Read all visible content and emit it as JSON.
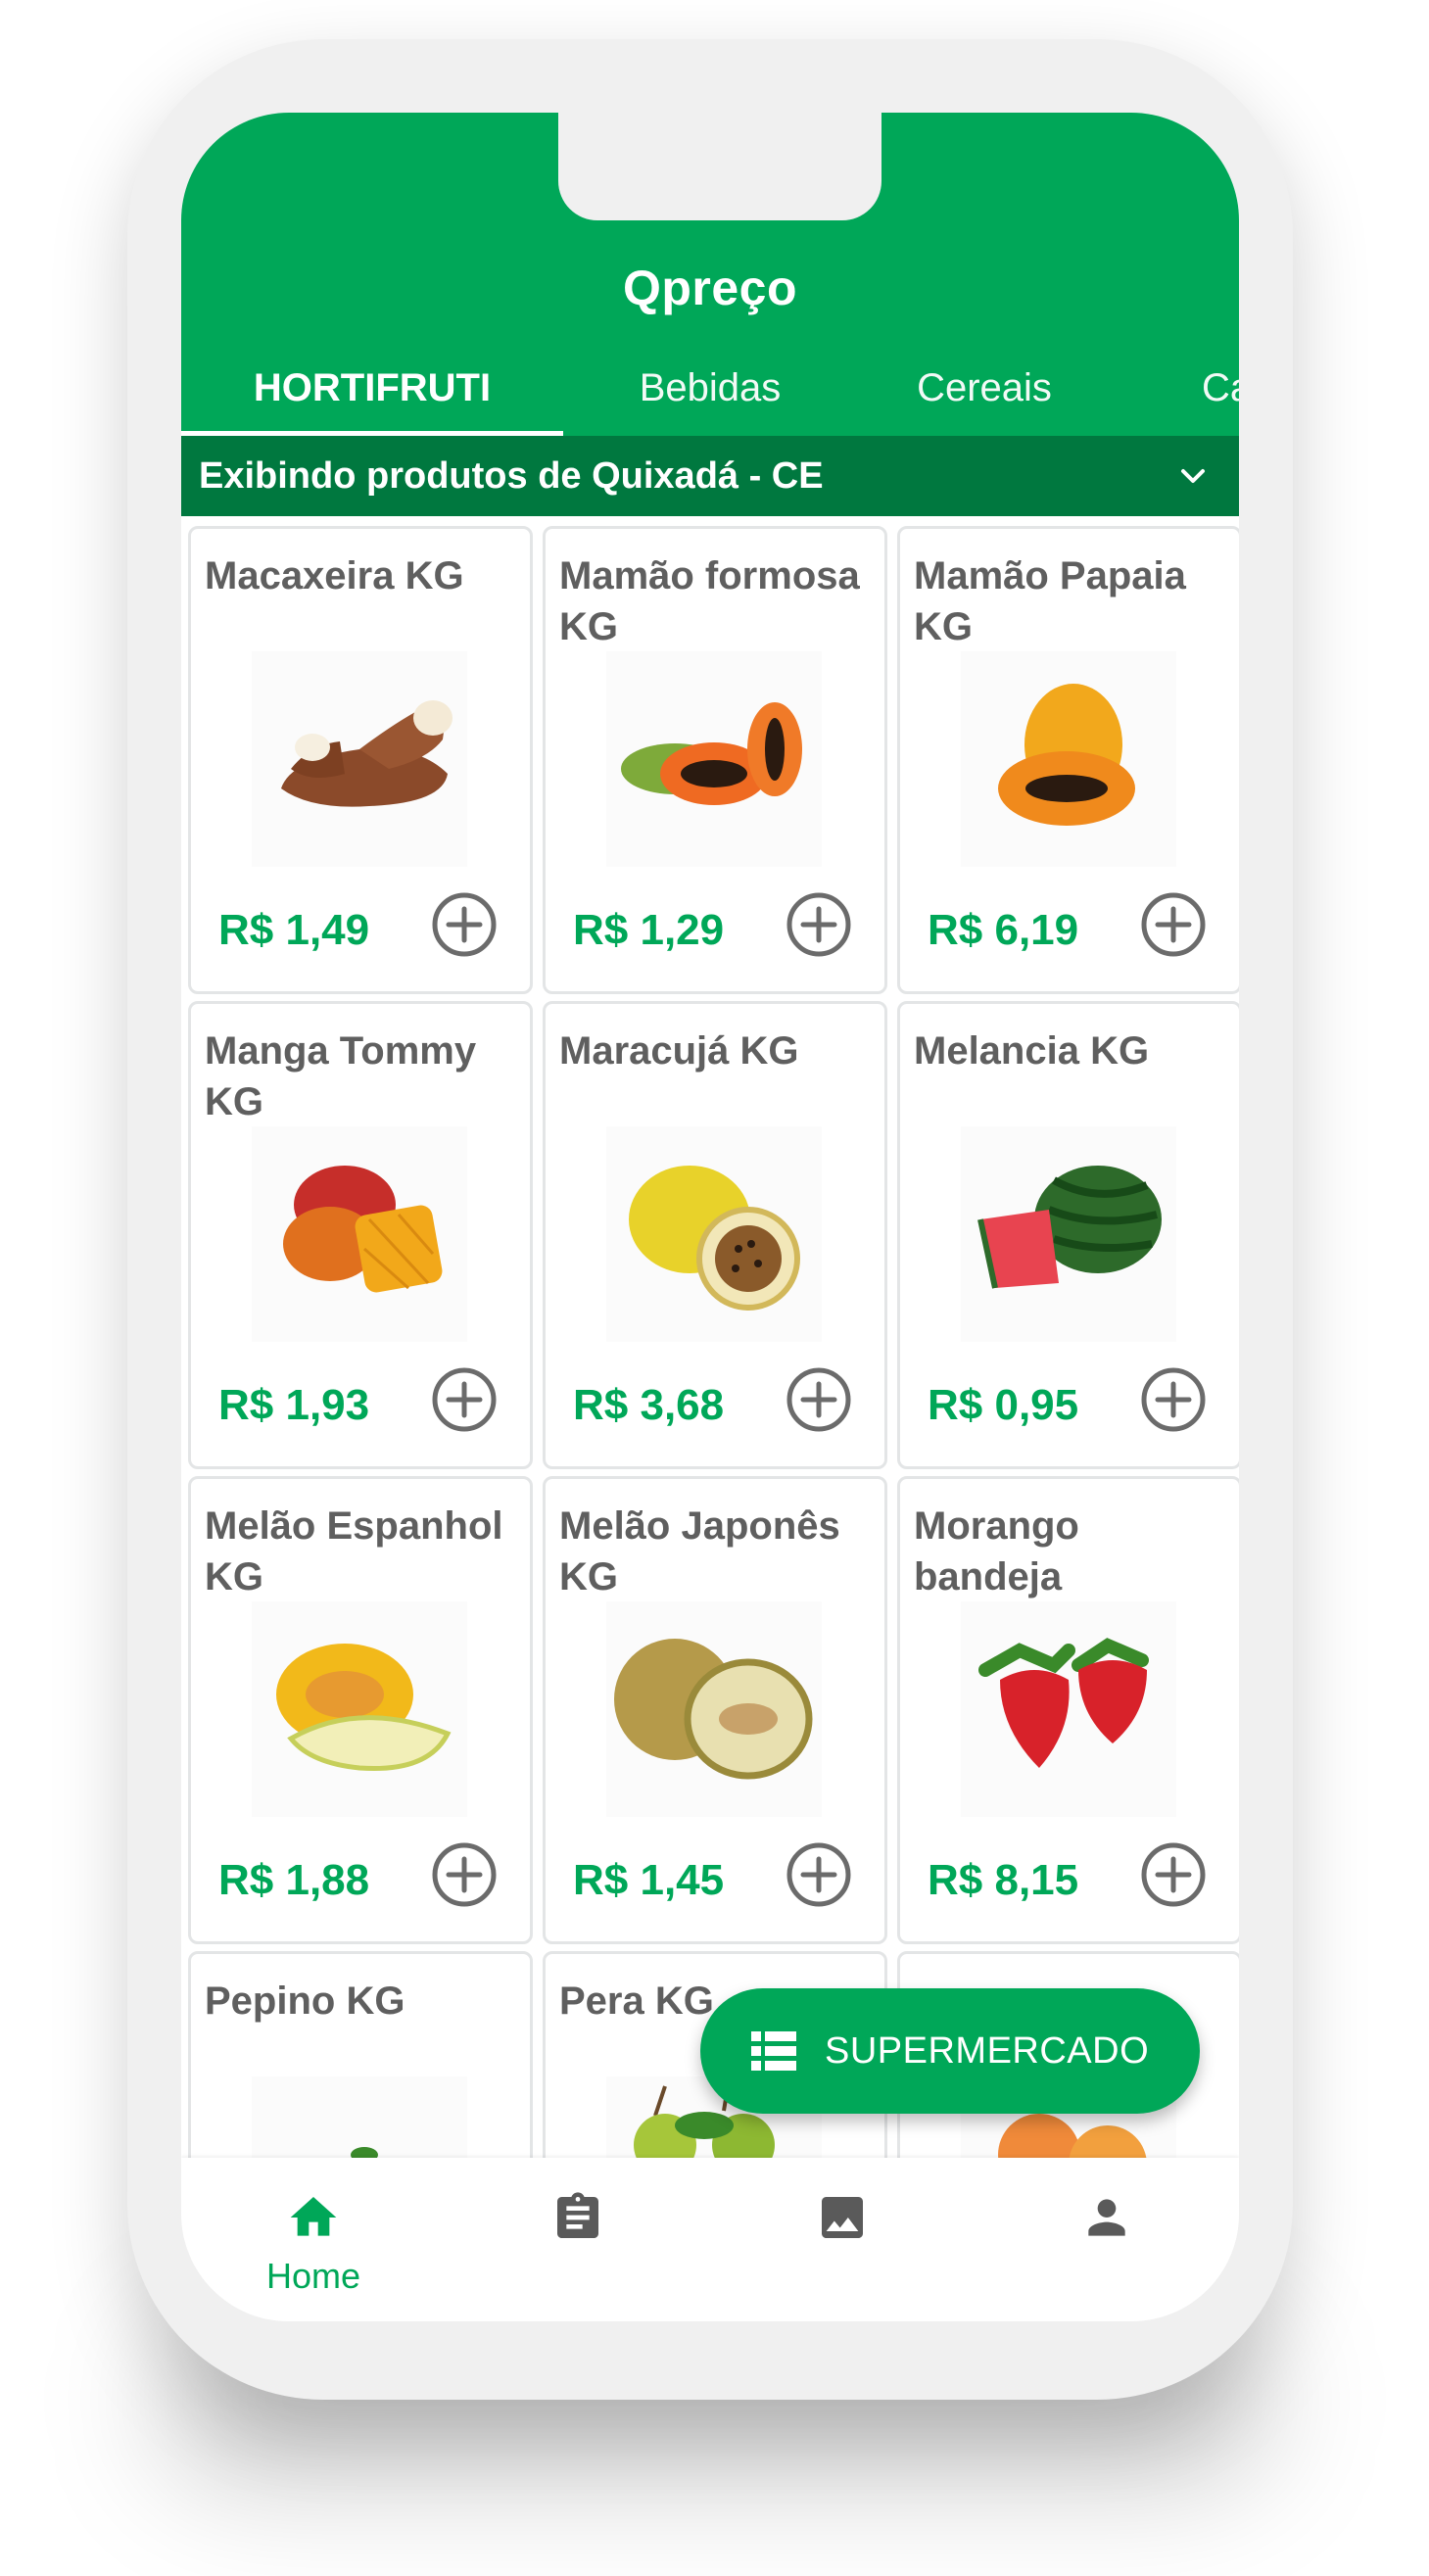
{
  "app": {
    "title": "Qpreço"
  },
  "tabs": [
    {
      "label": "HORTIFRUTI",
      "active": true
    },
    {
      "label": "Bebidas",
      "active": false
    },
    {
      "label": "Cereais",
      "active": false
    },
    {
      "label": "Ca",
      "active": false
    }
  ],
  "location": {
    "text": "Exibindo produtos de Quixadá - CE"
  },
  "products": [
    {
      "name": "Macaxeira  KG",
      "price": "R$ 1,49",
      "image": "cassava"
    },
    {
      "name": "Mamão formosa  KG",
      "price": "R$ 1,29",
      "image": "papaya"
    },
    {
      "name": "Mamão Papaia KG",
      "price": "R$ 6,19",
      "image": "papaya-small"
    },
    {
      "name": "Manga Tommy KG",
      "price": "R$ 1,93",
      "image": "mango"
    },
    {
      "name": "Maracujá  KG",
      "price": "R$ 3,68",
      "image": "passion-fruit"
    },
    {
      "name": "Melancia  KG",
      "price": "R$ 0,95",
      "image": "watermelon"
    },
    {
      "name": "Melão Espanhol KG",
      "price": "R$ 1,88",
      "image": "spanish-melon"
    },
    {
      "name": "Melão Japonês KG",
      "price": "R$ 1,45",
      "image": "japanese-melon"
    },
    {
      "name": "Morango bandeja",
      "price": "R$ 8,15",
      "image": "strawberry"
    },
    {
      "name": "Pepino  KG",
      "price": "",
      "image": "cucumber"
    },
    {
      "name": "Pera  KG",
      "price": "",
      "image": "pear"
    },
    {
      "name": "",
      "price": "",
      "image": "peach"
    }
  ],
  "fab": {
    "label": "SUPERMERCADO",
    "icon": "list-icon"
  },
  "bottom_nav": [
    {
      "label": "Home",
      "icon": "home-icon",
      "active": true
    },
    {
      "label": "",
      "icon": "clipboard-icon",
      "active": false
    },
    {
      "label": "",
      "icon": "image-icon",
      "active": false
    },
    {
      "label": "",
      "icon": "person-icon",
      "active": false
    }
  ],
  "colors": {
    "primary": "#00a758",
    "primary_dark": "#00783f",
    "text": "#5f5f5f"
  }
}
